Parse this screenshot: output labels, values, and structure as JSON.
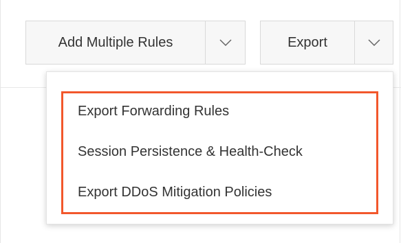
{
  "toolbar": {
    "add_multiple_rules_label": "Add Multiple Rules",
    "export_label": "Export",
    "add_toggle_icon": "chevron-down-icon",
    "export_toggle_icon": "chevron-down-icon"
  },
  "export_menu": {
    "items": [
      {
        "label": "Export Forwarding Rules"
      },
      {
        "label": "Session Persistence & Health-Check"
      },
      {
        "label": "Export DDoS Mitigation Policies"
      }
    ]
  },
  "colors": {
    "highlight_border": "#f2572b",
    "button_background": "#f7f7f7",
    "text": "#333333"
  }
}
